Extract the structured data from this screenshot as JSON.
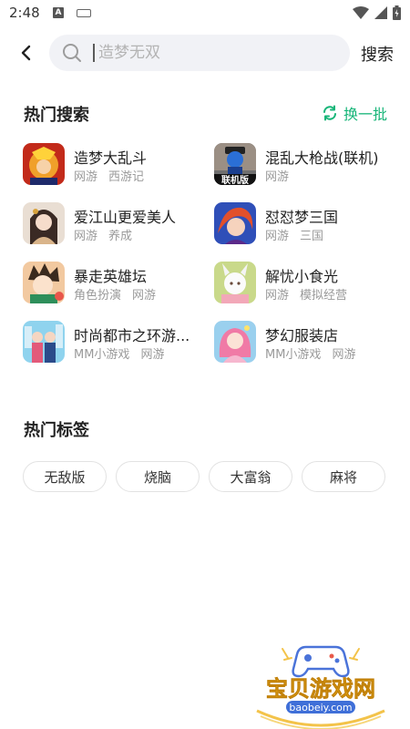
{
  "status_bar": {
    "time": "2:48",
    "notification_letter": "A"
  },
  "search": {
    "placeholder": "造梦无双",
    "submit_label": "搜索"
  },
  "hot_search": {
    "title": "热门搜索",
    "refresh_label": "换一批",
    "accent_color": "#16b578",
    "games": [
      {
        "name": "造梦大乱斗",
        "tags": [
          "网游",
          "西游记"
        ],
        "icon": "game-icon-zaomeng"
      },
      {
        "name": "混乱大枪战(联机)",
        "tags": [
          "网游"
        ],
        "icon": "game-icon-hunluan",
        "badge": "联机版"
      },
      {
        "name": "爱江山更爱美人",
        "tags": [
          "网游",
          "养成"
        ],
        "icon": "game-icon-aijiangshan"
      },
      {
        "name": "怼怼梦三国",
        "tags": [
          "网游",
          "三国"
        ],
        "icon": "game-icon-duidui"
      },
      {
        "name": "暴走英雄坛",
        "tags": [
          "角色扮演",
          "网游"
        ],
        "icon": "game-icon-baozou"
      },
      {
        "name": "解忧小食光",
        "tags": [
          "网游",
          "模拟经营"
        ],
        "icon": "game-icon-jieyou"
      },
      {
        "name": "时尚都市之环游...",
        "tags": [
          "MM小游戏",
          "网游"
        ],
        "icon": "game-icon-shishang"
      },
      {
        "name": "梦幻服装店",
        "tags": [
          "MM小游戏",
          "网游"
        ],
        "icon": "game-icon-menghuan"
      }
    ]
  },
  "hot_tags": {
    "title": "热门标签",
    "tags": [
      "无敌版",
      "烧脑",
      "大富翁",
      "麻将"
    ]
  },
  "watermark": {
    "name": "宝贝游戏网",
    "url": "baobeiy.com"
  }
}
